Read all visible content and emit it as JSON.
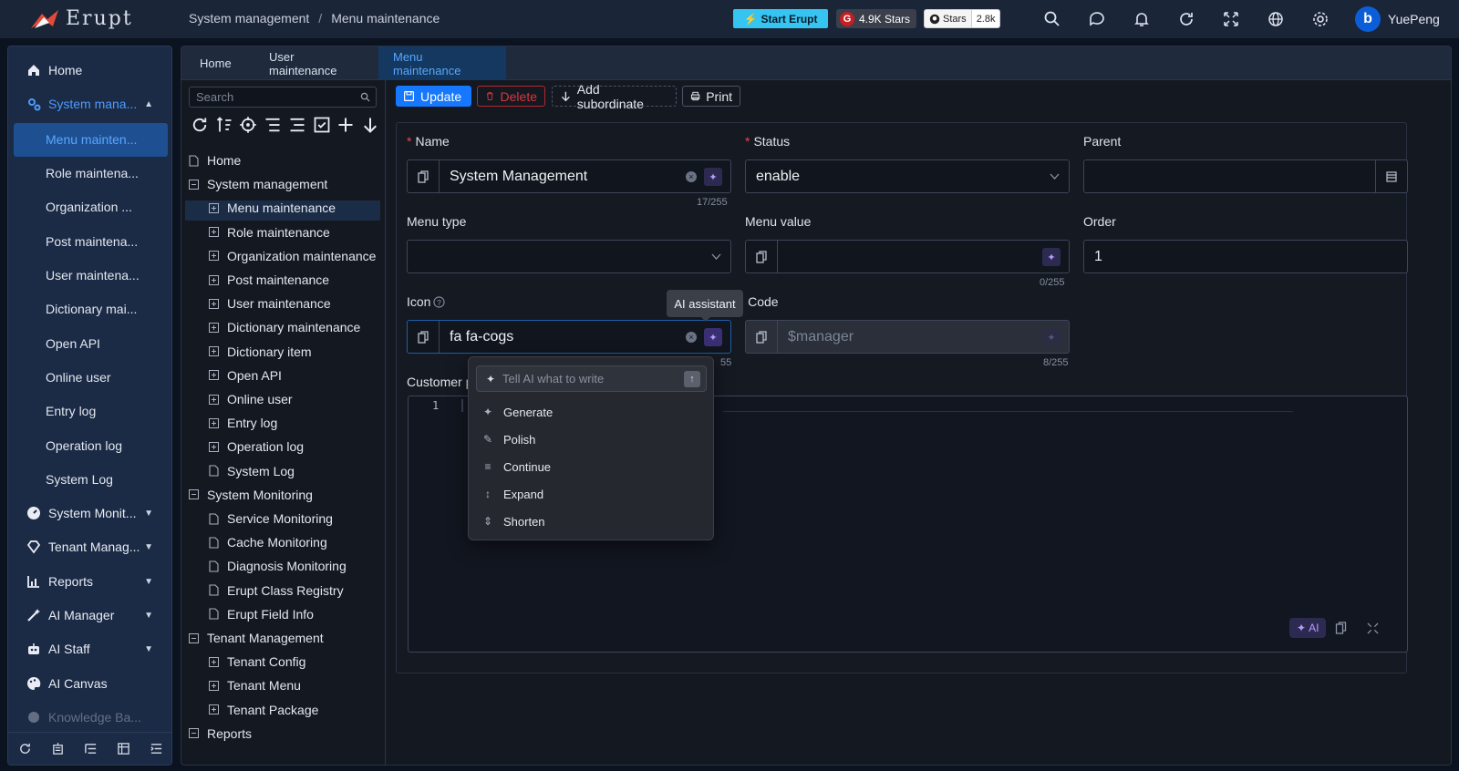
{
  "app": {
    "logo_text": "Erupt",
    "user_name": "YuePeng",
    "avatar_letter": "b"
  },
  "breadcrumb": {
    "items": [
      "System management",
      "Menu maintenance"
    ],
    "separator": "/"
  },
  "badges": {
    "start": "Start Erupt",
    "gitee": "4.9K Stars",
    "github_label": "Stars",
    "github_count": "2.8k"
  },
  "top_icons": [
    "search-icon",
    "chat-icon",
    "bell-icon",
    "refresh-icon",
    "fullscreen-icon",
    "globe-icon",
    "gear-icon"
  ],
  "sidebar": {
    "items": [
      {
        "label": "Home",
        "icon": "home-icon"
      },
      {
        "label": "System mana...",
        "icon": "cogs-icon",
        "expanded": true
      },
      {
        "label": "System Monit...",
        "icon": "dashboard-icon"
      },
      {
        "label": "Tenant Manag...",
        "icon": "diamond-icon"
      },
      {
        "label": "Reports",
        "icon": "chart-icon"
      },
      {
        "label": "AI Manager",
        "icon": "wand-icon"
      },
      {
        "label": "AI Staff",
        "icon": "robot-icon"
      },
      {
        "label": "AI Canvas",
        "icon": "palette-icon"
      },
      {
        "label": "Knowledge Ba...",
        "icon": "brain-icon"
      }
    ],
    "sub_items": [
      "Menu mainten...",
      "Role maintena...",
      "Organization ...",
      "Post maintena...",
      "User maintena...",
      "Dictionary mai...",
      "Open API",
      "Online user",
      "Entry log",
      "Operation log",
      "System Log"
    ]
  },
  "tabs": [
    {
      "label": "Home"
    },
    {
      "label": "User maintenance"
    },
    {
      "label": "Menu maintenance",
      "active": true
    }
  ],
  "tree": {
    "search_placeholder": "Search",
    "nodes": [
      {
        "label": "Home",
        "kind": "doc",
        "level": 0
      },
      {
        "label": "System management",
        "kind": "minus",
        "level": 0,
        "selected": true
      },
      {
        "label": "Menu maintenance",
        "kind": "plus",
        "level": 1
      },
      {
        "label": "Role maintenance",
        "kind": "plus",
        "level": 1
      },
      {
        "label": "Organization maintenance",
        "kind": "plus",
        "level": 1
      },
      {
        "label": "Post maintenance",
        "kind": "plus",
        "level": 1
      },
      {
        "label": "User maintenance",
        "kind": "plus",
        "level": 1
      },
      {
        "label": "Dictionary maintenance",
        "kind": "plus",
        "level": 1
      },
      {
        "label": "Dictionary item",
        "kind": "plus",
        "level": 1
      },
      {
        "label": "Open API",
        "kind": "plus",
        "level": 1
      },
      {
        "label": "Online user",
        "kind": "plus",
        "level": 1
      },
      {
        "label": "Entry log",
        "kind": "plus",
        "level": 1
      },
      {
        "label": "Operation log",
        "kind": "plus",
        "level": 1
      },
      {
        "label": "System Log",
        "kind": "doc",
        "level": 1
      },
      {
        "label": "System Monitoring",
        "kind": "minus",
        "level": 0
      },
      {
        "label": "Service Monitoring",
        "kind": "doc",
        "level": 1
      },
      {
        "label": "Cache Monitoring",
        "kind": "doc",
        "level": 1
      },
      {
        "label": "Diagnosis Monitoring",
        "kind": "doc",
        "level": 1
      },
      {
        "label": "Erupt Class Registry",
        "kind": "doc",
        "level": 1
      },
      {
        "label": "Erupt Field Info",
        "kind": "doc",
        "level": 1
      },
      {
        "label": "Tenant Management",
        "kind": "minus",
        "level": 0
      },
      {
        "label": "Tenant Config",
        "kind": "plus",
        "level": 1
      },
      {
        "label": "Tenant Menu",
        "kind": "plus",
        "level": 1
      },
      {
        "label": "Tenant Package",
        "kind": "plus",
        "level": 1
      },
      {
        "label": "Reports",
        "kind": "minus",
        "level": 0
      }
    ]
  },
  "toolbar": {
    "update": "Update",
    "delete": "Delete",
    "add_sub": "Add subordinate",
    "print": "Print"
  },
  "form": {
    "name": {
      "label": "Name",
      "value": "System Management",
      "count": "17/255"
    },
    "status": {
      "label": "Status",
      "value": "enable"
    },
    "parent": {
      "label": "Parent",
      "value": ""
    },
    "menu_type": {
      "label": "Menu type",
      "value": ""
    },
    "menu_value": {
      "label": "Menu value",
      "value": "",
      "count": "0/255"
    },
    "order": {
      "label": "Order",
      "value": "1"
    },
    "icon": {
      "label": "Icon",
      "value": "fa fa-cogs",
      "count_partial": "55"
    },
    "code": {
      "label": "Code",
      "value": "$manager",
      "count": "8/255"
    },
    "customer": {
      "label": "Customer pa"
    },
    "editor": {
      "line_number": "1",
      "ai_label": "AI"
    }
  },
  "tooltip": "AI assistant",
  "ai_menu": {
    "placeholder": "Tell AI what to write",
    "items": [
      {
        "label": "Generate",
        "icon": "sparkle-icon"
      },
      {
        "label": "Polish",
        "icon": "pen-icon"
      },
      {
        "label": "Continue",
        "icon": "continue-icon"
      },
      {
        "label": "Expand",
        "icon": "expand-icon"
      },
      {
        "label": "Shorten",
        "icon": "shorten-icon"
      }
    ]
  }
}
